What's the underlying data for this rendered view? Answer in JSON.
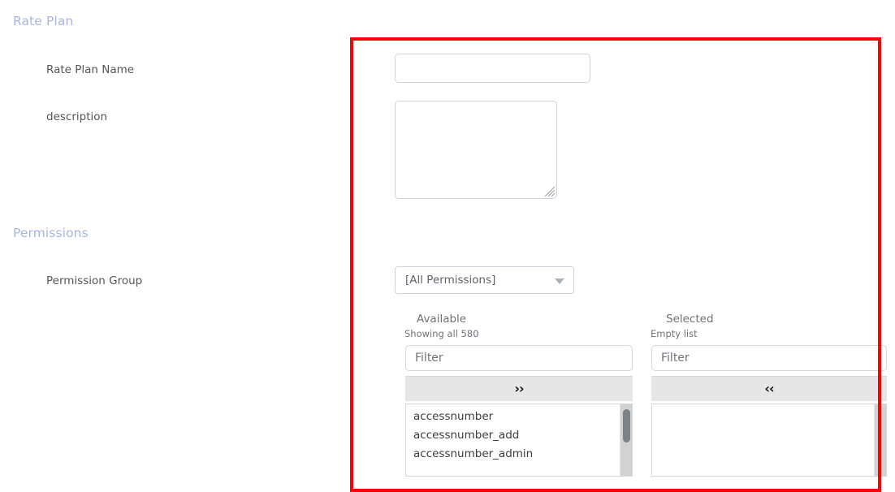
{
  "sections": {
    "rate_plan": {
      "heading": "Rate Plan",
      "fields": {
        "rate_plan_name": {
          "label": "Rate Plan Name",
          "value": "",
          "placeholder": ""
        },
        "description": {
          "label": "description",
          "value": "",
          "placeholder": ""
        }
      }
    },
    "permissions": {
      "heading": "Permissions",
      "fields": {
        "permission_group": {
          "label": "Permission Group",
          "selected_value": "[All Permissions]",
          "caret_icon": "chevron-down-icon"
        }
      },
      "picker": {
        "available": {
          "title": "Available",
          "subtitle": "Showing all 580",
          "filter_placeholder": "Filter",
          "filter_value": "",
          "move_button_label": "››",
          "items": [
            "accessnumber",
            "accessnumber_add",
            "accessnumber_admin"
          ],
          "has_scrollbar": true
        },
        "selected": {
          "title": "Selected",
          "subtitle": "Empty list",
          "filter_placeholder": "Filter",
          "filter_value": "",
          "move_button_label": "‹‹",
          "items": [],
          "has_scrollbar": true
        }
      }
    }
  },
  "annotation": {
    "highlight_color": "#fb0007"
  },
  "colors": {
    "section_heading": "#a9b5e2",
    "field_label": "#555555",
    "input_border": "#ccd4e0",
    "button_background": "#e6e6e6",
    "scrollbar_track": "#d2d2d2",
    "scrollbar_thumb": "#7d8287"
  }
}
